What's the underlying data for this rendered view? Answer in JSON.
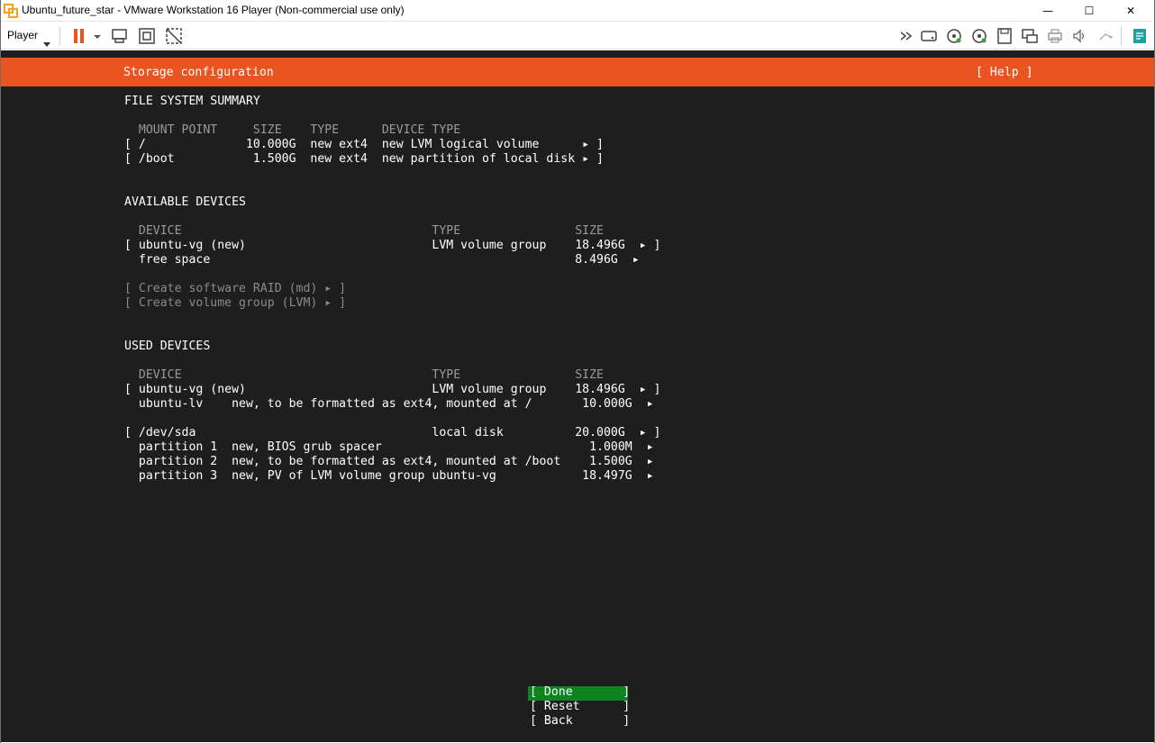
{
  "window": {
    "title": "Ubuntu_future_star - VMware Workstation 16 Player (Non-commercial use only)",
    "minimize": "—",
    "maximize": "☐",
    "close": "✕"
  },
  "toolbar": {
    "player_label": "Player",
    "icons": [
      "pause-icon",
      "send-ctrl-alt-del-icon",
      "fullscreen-icon",
      "unity-icon",
      "forward-icon",
      "hard-disk-icon",
      "cd-dvd-icon",
      "cd-dvd-2-icon",
      "floppy-icon",
      "network-adapter-icon",
      "printer-icon",
      "sound-card-icon",
      "usb-icon",
      "messages-icon"
    ],
    "colors": {
      "pause": "#e95420",
      "messages": "#20a0a0"
    }
  },
  "installer": {
    "header_title": "Storage configuration",
    "help_label": "[ Help ]",
    "colors": {
      "header": "#e95420",
      "background": "#1e1e1e",
      "done_button": "#0e8420"
    },
    "fs_summary": {
      "heading": "FILE SYSTEM SUMMARY",
      "columns": "  MOUNT POINT     SIZE    TYPE      DEVICE TYPE",
      "rows": [
        "[ /              10.000G  new ext4  new LVM logical volume      ▸ ]",
        "[ /boot           1.500G  new ext4  new partition of local disk ▸ ]"
      ]
    },
    "available": {
      "heading": "AVAILABLE DEVICES",
      "columns": "  DEVICE                                   TYPE                SIZE",
      "rows": [
        "[ ubuntu-vg (new)                          LVM volume group    18.496G  ▸ ]",
        "  free space                                                   8.496G  ▸"
      ],
      "actions": [
        "[ Create software RAID (md) ▸ ]",
        "[ Create volume group (LVM) ▸ ]"
      ]
    },
    "used": {
      "heading": "USED DEVICES",
      "columns": "  DEVICE                                   TYPE                SIZE",
      "rows": [
        "[ ubuntu-vg (new)                          LVM volume group    18.496G  ▸ ]",
        "  ubuntu-lv    new, to be formatted as ext4, mounted at /       10.000G  ▸",
        "[ /dev/sda                                 local disk          20.000G  ▸ ]",
        "  partition 1  new, BIOS grub spacer                             1.000M  ▸",
        "  partition 2  new, to be formatted as ext4, mounted at /boot    1.500G  ▸",
        "  partition 3  new, PV of LVM volume group ubuntu-vg            18.497G  ▸"
      ]
    },
    "buttons": {
      "done": "[ Done       ]",
      "reset": "[ Reset      ]",
      "back": "[ Back       ]"
    }
  }
}
